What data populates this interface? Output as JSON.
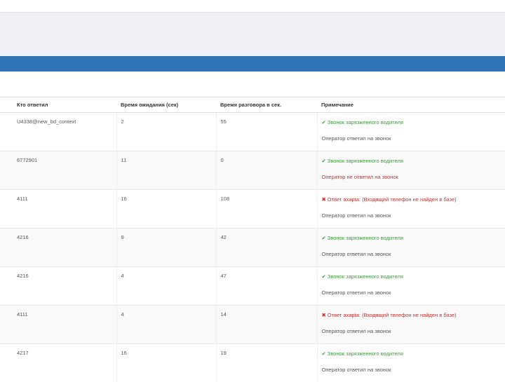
{
  "table": {
    "headers": [
      "Кто ответил",
      "Время ожидания (сек)",
      "Время разговора в сек.",
      "Примечание"
    ],
    "rows": [
      {
        "who": "U4338@new_bd_context",
        "wait": "2",
        "talk": "55",
        "note1": {
          "text": "Звонок зарязженного водителя",
          "status": "ok",
          "icon": "check-icon"
        },
        "note2": {
          "text": "Оператор ответил на звонок",
          "status": "neutral"
        }
      },
      {
        "who": "6772901",
        "wait": "11",
        "talk": "0",
        "note1": {
          "text": "Звонок зарязженного водителя",
          "status": "ok",
          "icon": "check-icon"
        },
        "note2": {
          "text": "Оператор не ответил на звонок",
          "status": "err"
        }
      },
      {
        "who": "4111",
        "wait": "16",
        "talk": "108",
        "note1": {
          "text": "Ответ axaptа: (Входящий телефон не найден в базе)",
          "status": "err",
          "icon": "cross-icon"
        },
        "note2": {
          "text": "Оператор ответил на звонок",
          "status": "neutral"
        }
      },
      {
        "who": "4216",
        "wait": "9",
        "talk": "42",
        "note1": {
          "text": "Звонок зарязженного водителя",
          "status": "ok",
          "icon": "check-icon"
        },
        "note2": {
          "text": "Оператор ответил на звонок",
          "status": "neutral"
        }
      },
      {
        "who": "4216",
        "wait": "4",
        "talk": "47",
        "note1": {
          "text": "Звонок зарязженного водителя",
          "status": "ok",
          "icon": "check-icon"
        },
        "note2": {
          "text": "Оператор ответил на звонок",
          "status": "neutral"
        }
      },
      {
        "who": "4111",
        "wait": "4",
        "talk": "14",
        "note1": {
          "text": "Ответ axaptа: (Входящий телефон не найден в базе)",
          "status": "err",
          "icon": "cross-icon"
        },
        "note2": {
          "text": "Оператор ответил на звонок",
          "status": "neutral"
        }
      },
      {
        "who": "4217",
        "wait": "16",
        "talk": "19",
        "note1": {
          "text": "Звонок зарязженного водителя",
          "status": "ok",
          "icon": "check-icon"
        },
        "note2": {
          "text": "Оператор ответил на звонок",
          "status": "neutral"
        }
      }
    ]
  },
  "colors": {
    "accent_bar": "#2f75b5",
    "ok": "#3c9b3c",
    "error": "#c9302c"
  }
}
